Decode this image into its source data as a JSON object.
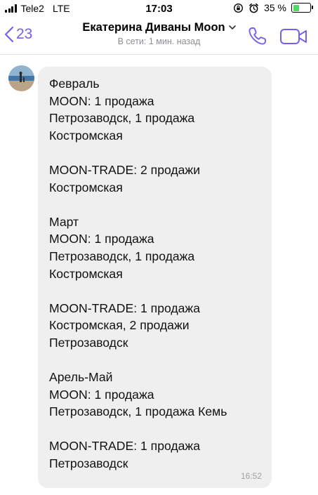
{
  "status_bar": {
    "carrier": "Tele2",
    "network": "LTE",
    "time": "17:03",
    "battery_percent_label": "35 %",
    "battery_level": 0.35,
    "icons": [
      "signal-icon",
      "orientation-lock-icon",
      "alarm-icon",
      "battery-icon"
    ]
  },
  "nav": {
    "back_count": "23",
    "title": "Екатерина Диваны Moon",
    "subtitle": "В сети: 1 мин. назад",
    "accent_color": "#7360f2",
    "icons": [
      "back-chevron-icon",
      "chevron-down-icon",
      "phone-icon",
      "video-camera-icon"
    ]
  },
  "message": {
    "text": "Февраль\nMOON: 1 продажа\nПетрозаводск, 1 продажа\nКостромская\n\nMOON-TRADE: 2 продажи\nКостромская\n\nМарт\nMOON: 1 продажа\nПетрозаводск, 1 продажа\nКостромская\n\nMOON-TRADE: 1 продажа\nКостромская, 2 продажи\nПетрозаводск\n\nАрель-Май\nMOON: 1 продажа\nПетрозаводск, 1 продажа Кемь\n\nMOON-TRADE: 1 продажа\nПетрозаводск",
    "time": "16:52",
    "bubble_color": "#efefef"
  }
}
